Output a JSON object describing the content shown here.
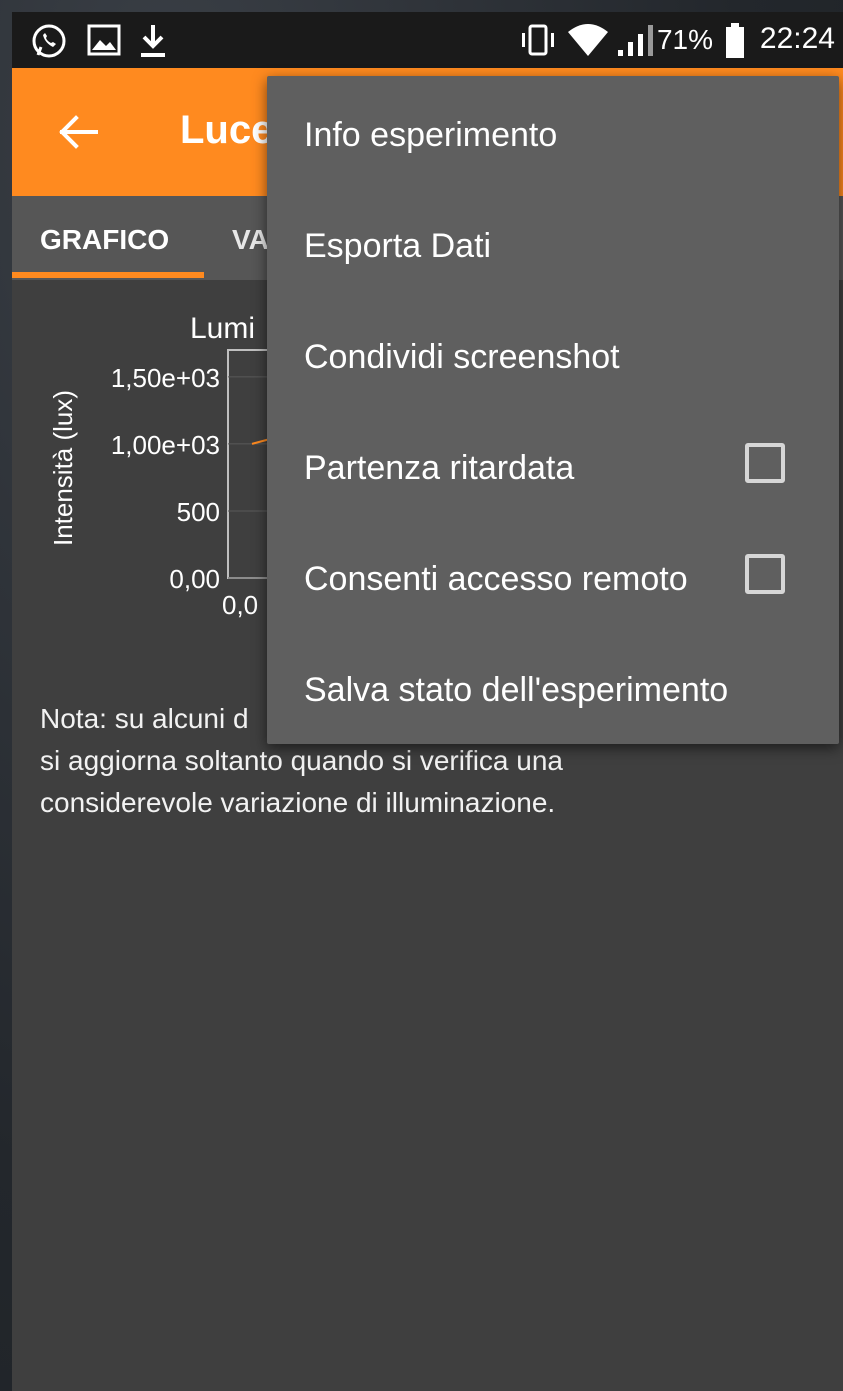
{
  "status_bar": {
    "battery_percent": "71%",
    "time": "22:24",
    "icons": [
      "whatsapp-icon",
      "image-icon",
      "download-icon",
      "vibrate-icon",
      "wifi-icon",
      "signal-icon",
      "battery-icon"
    ]
  },
  "app_bar": {
    "title": "Luce",
    "back_icon": "arrow-left-icon"
  },
  "tabs": [
    {
      "label": "GRAFICO",
      "selected": true
    },
    {
      "label": "VA",
      "selected": false
    }
  ],
  "chart_data": {
    "type": "line",
    "title": "Lumi",
    "ylabel": "Intensità (lux)",
    "ytick_labels": [
      "1,50e+03",
      "1,00e+03",
      "500",
      "0,00"
    ],
    "yticks": [
      1500,
      1000,
      500,
      0
    ],
    "xtick_labels": [
      "0,0"
    ],
    "ylim": [
      0,
      1700
    ],
    "series": [
      {
        "values": [
          1000,
          1040
        ]
      }
    ],
    "line_color": "#ff8a1f"
  },
  "note": "Nota: su alcuni d",
  "note_line2": "si aggiorna soltanto quando si verifica una",
  "note_line3": "considerevole variazione di illuminazione.",
  "menu": {
    "items": [
      {
        "label": "Info esperimento",
        "checkbox": false
      },
      {
        "label": "Esporta Dati",
        "checkbox": false
      },
      {
        "label": "Condividi screenshot",
        "checkbox": false
      },
      {
        "label": "Partenza ritardata",
        "checkbox": true,
        "checked": false
      },
      {
        "label": "Consenti accesso remoto",
        "checkbox": true,
        "checked": false
      },
      {
        "label": "Salva stato dell'esperimento",
        "checkbox": false
      }
    ]
  },
  "colors": {
    "accent": "#ff8a1f",
    "menu_bg": "#5f5f5f",
    "content_bg": "#3f3f3f",
    "tab_bg": "#565656"
  }
}
